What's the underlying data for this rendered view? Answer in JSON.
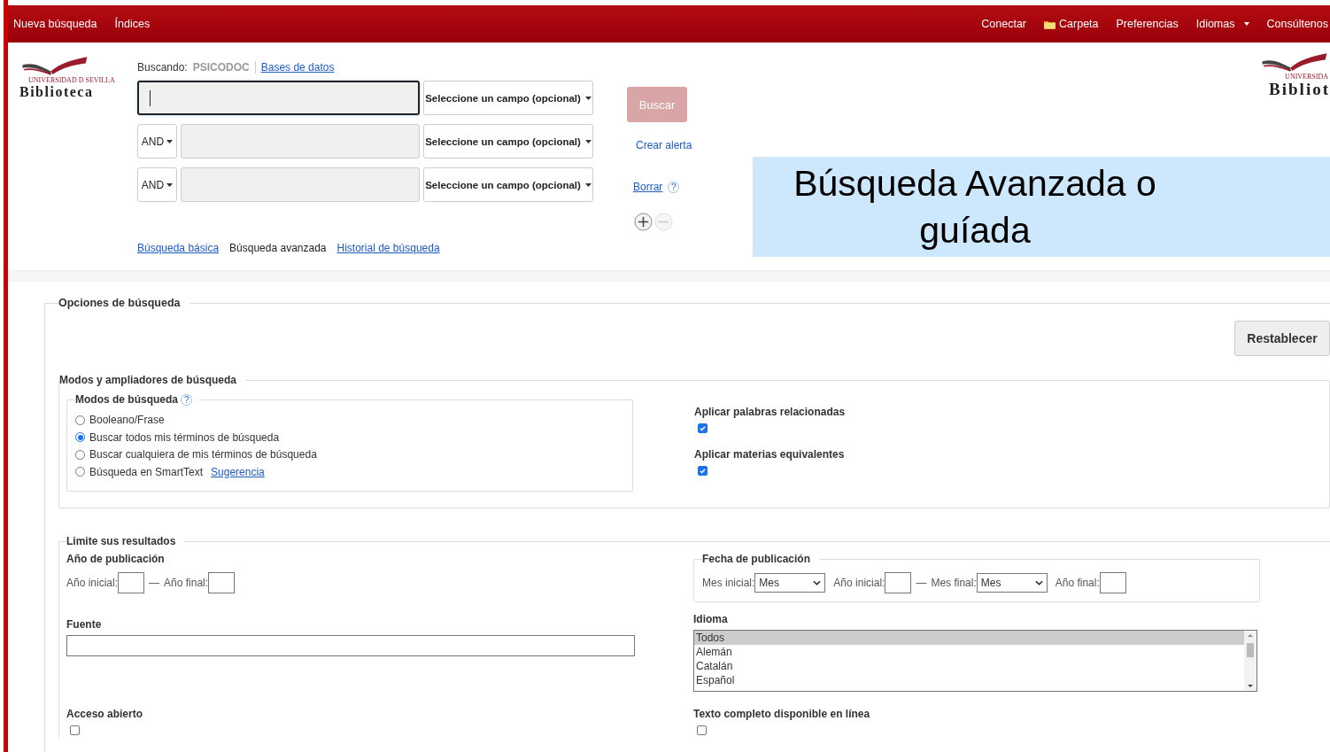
{
  "nav": {
    "left": [
      {
        "label": "Nueva búsqueda"
      },
      {
        "label": "Índices"
      }
    ],
    "right": [
      {
        "label": "Conectar",
        "kind": "plain"
      },
      {
        "label": "Carpeta",
        "kind": "folder"
      },
      {
        "label": "Preferencias",
        "kind": "plain"
      },
      {
        "label": "Idiomas",
        "kind": "dropdown"
      },
      {
        "label": "Consúltenos",
        "kind": "plain"
      }
    ]
  },
  "logo": {
    "university": "UNIVERSIDAD D SEVILLA",
    "name": "Biblioteca"
  },
  "searching": {
    "label": "Buscando:",
    "database": "PSICODOC",
    "link": "Bases de datos"
  },
  "search_rows": [
    {
      "focused": true,
      "field": "Seleccione un campo (opcional)"
    },
    {
      "operator": "AND",
      "focused": false,
      "field": "Seleccione un campo (opcional)"
    },
    {
      "operator": "AND",
      "focused": false,
      "field": "Seleccione un campo (opcional)"
    }
  ],
  "actions": {
    "help_icon": "?",
    "search_button": {
      "label": "Buscar",
      "disabled": true
    },
    "alert_link": "Crear alerta",
    "clear_link": "Borrar",
    "remove_row_disabled": true
  },
  "mode_links": [
    {
      "label": "Búsqueda básica",
      "selected": false
    },
    {
      "label": "Búsqueda avanzada",
      "selected": true
    },
    {
      "label": "Historial de búsqueda",
      "selected": false
    }
  ],
  "right_logo": {
    "university": "UNIVERSIDA",
    "name": "Bibliot"
  },
  "caption": "Búsqueda Avanzada o guíada",
  "options": {
    "title": "Opciones de búsqueda",
    "reset_button": "Restablecer",
    "modes_section": {
      "title": "Modos y ampliadores de búsqueda",
      "modes_title": "Modos de búsqueda",
      "help_icon": "?",
      "modes": [
        {
          "label": "Booleano/Frase",
          "selected": false
        },
        {
          "label": "Buscar todos mis términos de búsqueda",
          "selected": true
        },
        {
          "label": "Buscar cualquiera de mis términos de búsqueda",
          "selected": false
        },
        {
          "label": "Búsqueda en SmartText",
          "link": "Sugerencia",
          "selected": false
        }
      ],
      "expanders": [
        {
          "label": "Aplicar palabras relacionadas",
          "checked": true
        },
        {
          "label": "Aplicar materias equivalentes",
          "checked": true
        }
      ]
    },
    "limits": {
      "title": "Limite sus resultados",
      "year": {
        "title": "Año de publicación",
        "from": "Año inicial:",
        "dash": "—",
        "to": "Año final:"
      },
      "date": {
        "title": "Fecha de publicación",
        "month_from": "Mes inicial:",
        "month_from_value": "Mes",
        "year_from": "Año inicial:",
        "dash": "—",
        "month_to": "Mes final:",
        "month_to_value": "Mes",
        "year_to": "Año final:"
      },
      "source": {
        "title": "Fuente"
      },
      "language": {
        "title": "Idioma",
        "items": [
          {
            "label": "Todos",
            "selected": true
          },
          {
            "label": "Alemán",
            "selected": false
          },
          {
            "label": "Catalán",
            "selected": false
          },
          {
            "label": "Español",
            "selected": false
          }
        ]
      },
      "open_access": {
        "title": "Acceso abierto",
        "checked": false
      },
      "full_text": {
        "title": "Texto completo disponible en línea",
        "checked": false
      }
    }
  }
}
